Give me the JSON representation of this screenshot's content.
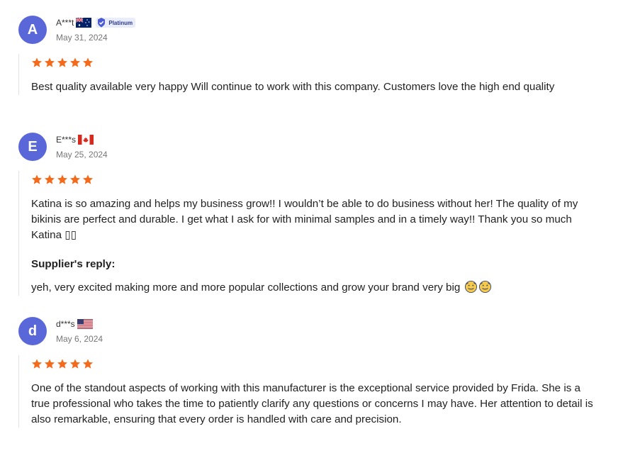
{
  "reviews": [
    {
      "initial": "A",
      "name": "A***t",
      "country": "Australia",
      "badge": "Platinum",
      "date": "May 31, 2024",
      "rating": 5,
      "text": "Best quality available very happy Will continue to work with this company. Customers love the high end quality"
    },
    {
      "initial": "E",
      "name": "E***s",
      "country": "Canada",
      "date": "May 25, 2024",
      "rating": 5,
      "text": "Katina is so amazing and helps my business grow!! I wouldn’t be able to do business without her! The quality of my bikinis are perfect and durable. I get what I ask for with minimal samples and in a timely way!! Thank you so much Katina ▯▯",
      "reply_label": "Supplier's reply:",
      "reply_text": "yeh, very excited making more and more popular collections and grow your brand very big",
      "reply_emoji": "smiling-face-icon"
    },
    {
      "initial": "d",
      "name": "d***s",
      "country": "United States",
      "date": "May 6, 2024",
      "rating": 5,
      "text": "One of the standout aspects of working with this manufacturer is the exceptional service provided by Frida. She is a true professional who takes the time to patiently clarify any questions or concerns I may have. Her attention to detail is also remarkable, ensuring that every order is handled with care and precision."
    }
  ],
  "colors": {
    "avatar": "#5a67d8",
    "star": "#f56a1a",
    "badge_bg": "#e8ecfb"
  }
}
